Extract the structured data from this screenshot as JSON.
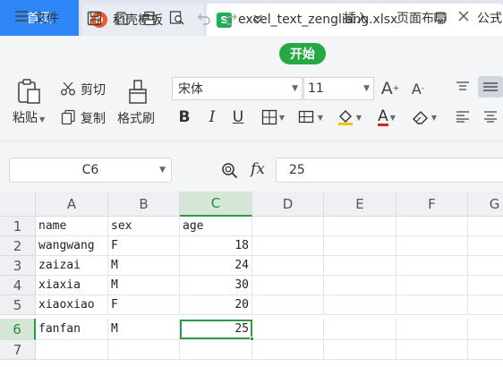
{
  "tabs": {
    "home": "首页",
    "templates": "稻壳模板",
    "templates_logo": "D",
    "file": "excel_text_zengliang.xlsx",
    "file_logo": "S"
  },
  "menu": {
    "file_label": "文件",
    "start": "开始",
    "insert": "插入",
    "page_layout": "页面布局",
    "formula": "公式"
  },
  "ribbon": {
    "paste": "粘贴",
    "cut": "剪切",
    "copy": "复制",
    "format_painter": "格式刷",
    "font_name": "宋体",
    "font_size": "11",
    "bold": "B",
    "italic": "I",
    "underline": "U",
    "font_color": "A",
    "grow_font": "A",
    "shrink_font": "A"
  },
  "formula_bar": {
    "cell_ref": "C6",
    "fx_label": "fx",
    "value": "25"
  },
  "sheet": {
    "columns": [
      "A",
      "B",
      "C",
      "D",
      "E",
      "F",
      "G"
    ],
    "rows": [
      "1",
      "2",
      "3",
      "4",
      "5",
      "6",
      "7"
    ],
    "cells": [
      [
        "name",
        "sex",
        "age"
      ],
      [
        "wangwang",
        "F",
        "18"
      ],
      [
        "zaizai",
        "M",
        "24"
      ],
      [
        "xiaxia",
        "M",
        "30"
      ],
      [
        "xiaoxiao",
        "F",
        "20"
      ],
      [
        "fanfan",
        "M",
        "25"
      ]
    ]
  },
  "colors": {
    "accent_blue": "#2f86f6",
    "start_green": "#28a745",
    "selection_green": "#2d9b46"
  }
}
